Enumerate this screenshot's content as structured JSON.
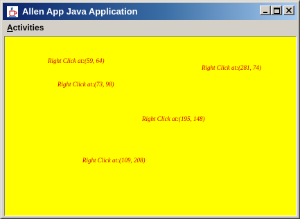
{
  "window": {
    "title": "Allen App Java Application"
  },
  "menubar": {
    "items": [
      {
        "label": "Activities"
      }
    ]
  },
  "canvas": {
    "background_color": "#ffff00",
    "label_color": "#cc0000",
    "click_labels": [
      {
        "text": "Right Click at:(59, 64)"
      },
      {
        "text": "Right Click at:(281, 74)"
      },
      {
        "text": "Right Click at:(73, 98)"
      },
      {
        "text": "Right Click at:(195, 148)"
      },
      {
        "text": "Right Click at:(109, 208)"
      }
    ]
  },
  "icons": {
    "app": "java-cup-icon",
    "minimize": "minimize-icon",
    "maximize": "maximize-icon",
    "close": "close-icon"
  }
}
